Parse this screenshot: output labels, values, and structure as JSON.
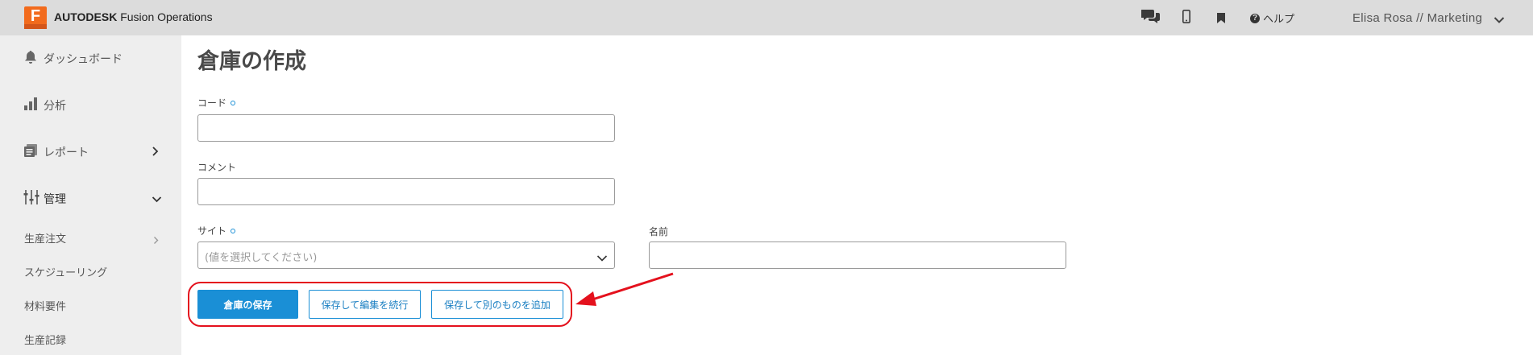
{
  "header": {
    "brand": "AUTODESK",
    "product": "Fusion Operations",
    "logo_letter": "F",
    "help_label": "ヘルプ",
    "user": "Elisa Rosa // Marketing",
    "icons": [
      "chat-icon",
      "mobile-icon",
      "bookmark-icon",
      "help-icon",
      "chevron-down-icon"
    ]
  },
  "sidebar": {
    "items": [
      {
        "label": "ダッシュボード",
        "icon": "bell-icon"
      },
      {
        "label": "分析",
        "icon": "bar-chart-icon"
      },
      {
        "label": "レポート",
        "icon": "report-icon"
      },
      {
        "label": "管理",
        "icon": "sliders-icon"
      }
    ],
    "sub_items": [
      {
        "label": "生産注文"
      },
      {
        "label": "スケジューリング"
      },
      {
        "label": "材料要件"
      },
      {
        "label": "生産記録"
      }
    ]
  },
  "main": {
    "title": "倉庫の作成",
    "fields": {
      "code_label": "コード",
      "code_value": "",
      "comment_label": "コメント",
      "comment_value": "",
      "site_label": "サイト",
      "site_placeholder": "(値を選択してください)",
      "name_label": "名前",
      "name_value": ""
    },
    "buttons": {
      "save": "倉庫の保存",
      "save_continue": "保存して編集を続行",
      "save_add": "保存して別のものを追加"
    }
  },
  "colors": {
    "accent": "#1a8fd6",
    "brand_orange": "#f26b1d",
    "annotation_red": "#e4111d",
    "topbar_bg": "#dcdcdc",
    "sidebar_bg": "#eeeeee"
  }
}
